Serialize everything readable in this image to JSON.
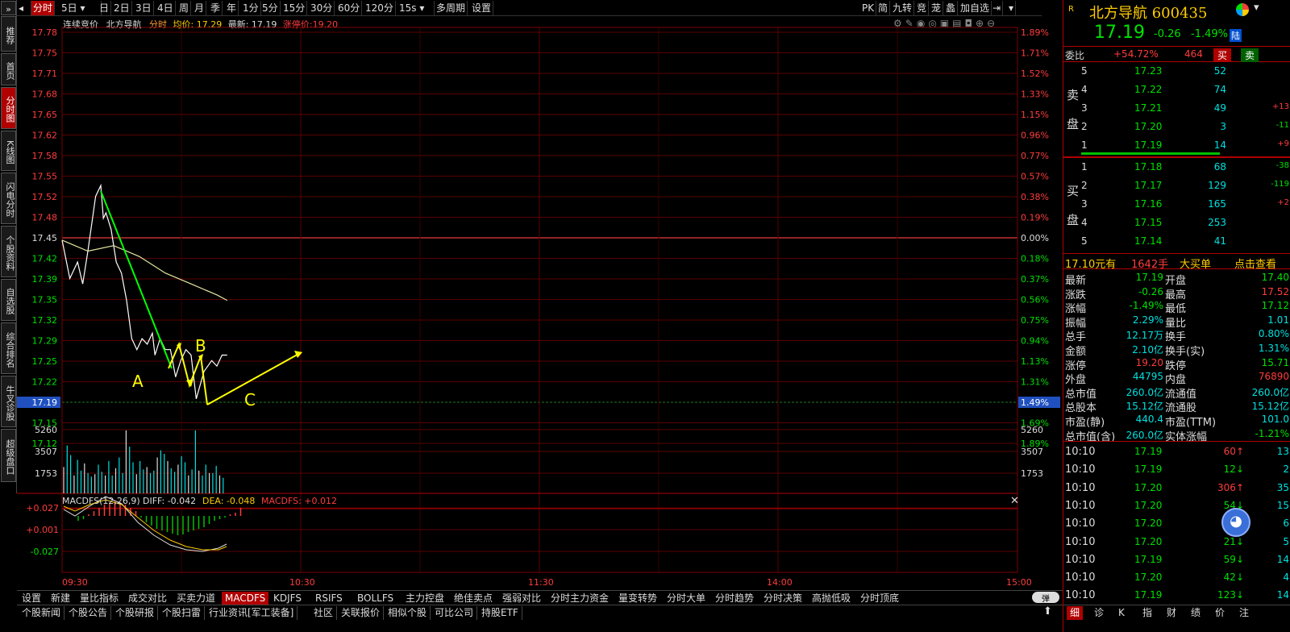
{
  "sidebar": {
    "items": [
      "推荐",
      "首页",
      "分时图",
      "K线图",
      "闪电分时",
      "个股资料",
      "自选股",
      "综合排名",
      "牛叉诊股",
      "超级盘口"
    ]
  },
  "toolbar": {
    "items": [
      "分时",
      "5日",
      "日",
      "2日",
      "3日",
      "4日",
      "周",
      "月",
      "季",
      "年",
      "1分",
      "5分",
      "15分",
      "30分",
      "60分",
      "120分",
      "15s",
      "多周期",
      "设置"
    ],
    "right": [
      "PK",
      "简",
      "九转",
      "竞",
      "茏",
      "蠡",
      "加自选"
    ]
  },
  "info": {
    "auction": "连续竞价",
    "name": "北方导航",
    "mode": "分时",
    "avg_label": "均价: ",
    "avg": "17.29",
    "latest_label": "最新: ",
    "latest": "17.19",
    "limit_label": "涨停价:",
    "limit": "19.20"
  },
  "axis": {
    "prices": [
      "17.78",
      "17.75",
      "17.71",
      "17.68",
      "17.65",
      "17.62",
      "17.58",
      "17.55",
      "17.52",
      "17.48",
      "17.45",
      "17.42",
      "17.39",
      "17.35",
      "17.32",
      "17.29",
      "17.25",
      "17.22",
      "17.19",
      "17.15",
      "17.12"
    ],
    "pcts": [
      "1.89%",
      "1.71%",
      "1.52%",
      "1.33%",
      "1.15%",
      "0.96%",
      "0.77%",
      "0.57%",
      "0.38%",
      "0.19%",
      "0.00%",
      "0.18%",
      "0.37%",
      "0.56%",
      "0.75%",
      "0.94%",
      "1.13%",
      "1.31%",
      "1.49%",
      "1.69%",
      "1.89%"
    ],
    "vol": [
      "5260",
      "3507",
      "1753"
    ],
    "macd": [
      "+0.027",
      "+0.001",
      "-0.027"
    ],
    "times": [
      "09:30",
      "10:30",
      "11:30",
      "14:00",
      "15:00"
    ]
  },
  "macd_info": {
    "label": "MACDFS(12,26,9)",
    "diff": "DIFF: -0.042",
    "dea": "DEA: -0.048",
    "macdfs": "MACDFS: +0.012"
  },
  "annotations": [
    "A",
    "B",
    "C"
  ],
  "chart_data": {
    "type": "line",
    "title": "北方导航 分时",
    "ylim": [
      17.12,
      17.78
    ],
    "price_series": [
      {
        "name": "price",
        "x": [
          0,
          3,
          6,
          8,
          10,
          13,
          15,
          16,
          17,
          19,
          21,
          23,
          25,
          27,
          29,
          31,
          33,
          35,
          36,
          38,
          40,
          42,
          44,
          46,
          48,
          50,
          52,
          55,
          58,
          60,
          62,
          64
        ],
        "values": [
          17.4,
          17.33,
          17.36,
          17.32,
          17.38,
          17.48,
          17.5,
          17.44,
          17.45,
          17.42,
          17.36,
          17.34,
          17.29,
          17.22,
          17.2,
          17.22,
          17.21,
          17.23,
          17.19,
          17.22,
          17.2,
          17.2,
          17.15,
          17.18,
          17.2,
          17.19,
          17.11,
          17.16,
          17.18,
          17.17,
          17.19,
          17.19
        ]
      },
      {
        "name": "avg",
        "x": [
          0,
          10,
          20,
          30,
          40,
          50,
          60,
          64
        ],
        "values": [
          17.4,
          17.38,
          17.39,
          17.37,
          17.34,
          17.32,
          17.3,
          17.29
        ]
      }
    ],
    "volume": [
      2200,
      4000,
      3200,
      1500,
      2800,
      1900,
      2500,
      1700,
      1400,
      1600,
      2400,
      1800,
      1500,
      2700,
      1500,
      2100,
      3000,
      1700,
      5260,
      3900,
      2600,
      1600,
      2700,
      2000,
      2200,
      1700,
      1900,
      3000,
      3600,
      3300,
      2700,
      2100,
      1800,
      2400,
      3100,
      2600,
      1500,
      2000,
      5260,
      1900,
      1500,
      2400,
      1700,
      1700,
      2300,
      1500,
      1300
    ],
    "macd_hist": [
      -0.006,
      -0.004,
      0.002,
      0.006,
      0.01,
      0.014,
      0.016,
      0.018,
      0.017,
      0.014,
      0.01,
      0.006,
      -0.002,
      -0.008,
      -0.012,
      -0.016,
      -0.018,
      -0.02,
      -0.022,
      -0.024,
      -0.023,
      -0.02,
      -0.018,
      -0.016,
      -0.014,
      -0.01,
      -0.006,
      -0.004,
      -0.002,
      0.002,
      0.004,
      0.01
    ]
  },
  "quote": {
    "title": "北方导航 600435",
    "price": "17.19",
    "change": "-0.26",
    "pct": "-1.49%",
    "tag": "陆",
    "weibi_label": "委比",
    "weibi": "+54.72%",
    "weibi_diff": "464",
    "buy": "买",
    "sell": "卖",
    "sells": [
      {
        "lvl": "5",
        "price": "17.23",
        "vol": "52",
        "chg": ""
      },
      {
        "lvl": "4",
        "price": "17.22",
        "vol": "74",
        "chg": ""
      },
      {
        "lvl": "3",
        "price": "17.21",
        "vol": "49",
        "chg": "+13"
      },
      {
        "lvl": "2",
        "price": "17.20",
        "vol": "3",
        "chg": "-11"
      },
      {
        "lvl": "1",
        "price": "17.19",
        "vol": "14",
        "chg": "+9"
      }
    ],
    "buys": [
      {
        "lvl": "1",
        "price": "17.18",
        "vol": "68",
        "chg": "-38"
      },
      {
        "lvl": "2",
        "price": "17.17",
        "vol": "129",
        "chg": "-119"
      },
      {
        "lvl": "3",
        "price": "17.16",
        "vol": "165",
        "chg": "+2"
      },
      {
        "lvl": "4",
        "price": "17.15",
        "vol": "253",
        "chg": ""
      },
      {
        "lvl": "5",
        "price": "17.14",
        "vol": "41",
        "chg": ""
      }
    ],
    "sell_label": [
      "卖",
      "盘"
    ],
    "buy_label": [
      "买",
      "盘"
    ],
    "bigbuy": {
      "p": "17.10元有",
      "v": "1642手",
      "t": "大买单",
      "link": "点击查看"
    },
    "stats": [
      [
        "最新",
        "17.19",
        "开盘",
        "17.40"
      ],
      [
        "涨跌",
        "-0.26",
        "最高",
        "17.52"
      ],
      [
        "涨幅",
        "-1.49%",
        "最低",
        "17.12"
      ],
      [
        "振幅",
        "2.29%",
        "量比",
        "1.01"
      ],
      [
        "总手",
        "12.17万",
        "换手",
        "0.80%"
      ],
      [
        "金额",
        "2.10亿",
        "换手(实)",
        "1.31%"
      ],
      [
        "涨停",
        "19.20",
        "跌停",
        "15.71"
      ],
      [
        "外盘",
        "44795",
        "内盘",
        "76890"
      ],
      [
        "总市值",
        "260.0亿",
        "流通值",
        "260.0亿"
      ],
      [
        "总股本",
        "15.12亿",
        "流通股",
        "15.12亿"
      ],
      [
        "市盈(静)",
        "440.4",
        "市盈(TTM)",
        "101.0"
      ],
      [
        "总市值(含)",
        "260.0亿",
        "实体涨幅",
        "-1.21%"
      ]
    ],
    "ticks": [
      [
        "10:10",
        "17.19",
        "60",
        "13"
      ],
      [
        "10:10",
        "17.19",
        "12",
        "2"
      ],
      [
        "10:10",
        "17.20",
        "306",
        "35"
      ],
      [
        "10:10",
        "17.20",
        "54",
        "15"
      ],
      [
        "10:10",
        "17.20",
        "23",
        "6"
      ],
      [
        "10:10",
        "17.20",
        "21",
        "5"
      ],
      [
        "10:10",
        "17.19",
        "59",
        "14"
      ],
      [
        "10:10",
        "17.20",
        "42",
        "4"
      ],
      [
        "10:10",
        "17.19",
        "123",
        "14"
      ]
    ],
    "bottom_tabs": [
      "细",
      "诊",
      "K",
      "指",
      "财",
      "绩",
      "价",
      "注"
    ]
  },
  "indicator_tabs": [
    "设置",
    "新建",
    "量比指标",
    "成交对比",
    "买卖力道",
    "MACDFS",
    "KDJFS",
    "RSIFS",
    "BOLLFS",
    "主力控盘",
    "绝佳卖点",
    "强弱对比",
    "分时主力资金",
    "量变转势",
    "分时大单",
    "分时趋势",
    "分时决策",
    "高抛低吸",
    "分时顶底"
  ],
  "news_tabs": [
    "个股新闻",
    "个股公告",
    "个股研报",
    "个股扫雷",
    "行业资讯[军工装备]",
    "社区",
    "关联报价",
    "相似个股",
    "可比公司",
    "持股ETF"
  ],
  "bullet": "弹"
}
